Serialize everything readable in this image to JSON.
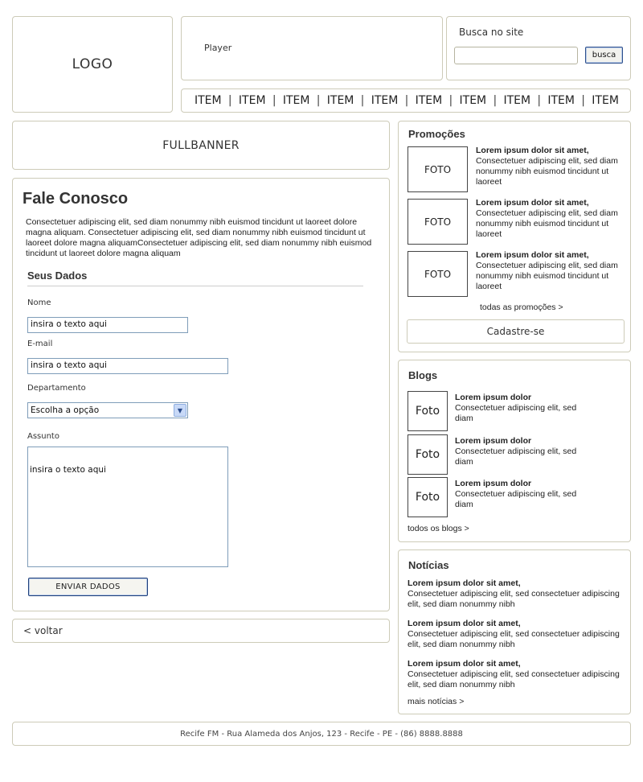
{
  "header": {
    "logo": "LOGO",
    "player": "Player",
    "search": {
      "label": "Busca no site",
      "value": "",
      "button": "busca"
    },
    "nav": {
      "items": [
        "ITEM",
        "ITEM",
        "ITEM",
        "ITEM",
        "ITEM",
        "ITEM",
        "ITEM",
        "ITEM",
        "ITEM",
        "ITEM"
      ],
      "separator": "|"
    }
  },
  "fullbanner": "FULLBANNER",
  "contact": {
    "title": "Fale Conosco",
    "intro": "Consectetuer adipiscing elit, sed diam nonummy nibh euismod tincidunt ut laoreet dolore magna aliquam. Consectetuer adipiscing elit, sed diam nonummy nibh euismod tincidunt ut laoreet dolore magna aliquamConsectetuer adipiscing elit, sed diam nonummy nibh euismod tincidunt ut laoreet dolore magna aliquam",
    "section": "Seus Dados",
    "name": {
      "label": "Nome",
      "value": "insira o texto aqui"
    },
    "email": {
      "label": "E-mail",
      "value": "insira o texto aqui"
    },
    "department": {
      "label": "Departamento",
      "value": "Escolha a opção"
    },
    "subject": {
      "label": "Assunto",
      "value": "insira o texto aqui"
    },
    "submit": "ENVIAR DADOS"
  },
  "back": "< voltar",
  "promos": {
    "title": "Promoções",
    "items": [
      {
        "photo": "FOTO",
        "title": "Lorem ipsum dolor sit amet,",
        "text": "Consectetuer adipiscing elit, sed diam nonummy nibh euismod tincidunt ut laoreet"
      },
      {
        "photo": "FOTO",
        "title": "Lorem ipsum dolor sit amet,",
        "text": "Consectetuer adipiscing elit, sed diam nonummy nibh euismod tincidunt ut laoreet"
      },
      {
        "photo": "FOTO",
        "title": "Lorem ipsum dolor sit amet,",
        "text": "Consectetuer adipiscing elit, sed diam nonummy nibh euismod tincidunt ut laoreet"
      }
    ],
    "more": "todas as promoções >",
    "signup": "Cadastre-se"
  },
  "blogs": {
    "title": "Blogs",
    "items": [
      {
        "photo": "Foto",
        "title": "Lorem ipsum dolor",
        "text": "Consectetuer adipiscing elit, sed diam"
      },
      {
        "photo": "Foto",
        "title": "Lorem ipsum dolor",
        "text": "Consectetuer adipiscing elit, sed diam"
      },
      {
        "photo": "Foto",
        "title": "Lorem ipsum dolor",
        "text": "Consectetuer adipiscing elit, sed diam"
      }
    ],
    "more": "todos os blogs >"
  },
  "news": {
    "title": "Notícias",
    "items": [
      {
        "title": "Lorem ipsum dolor sit amet,",
        "text": "Consectetuer adipiscing elit, sed consectetuer adipiscing elit, sed diam nonummy nibh"
      },
      {
        "title": "Lorem ipsum dolor sit amet,",
        "text": "Consectetuer adipiscing elit, sed consectetuer adipiscing elit, sed diam nonummy nibh"
      },
      {
        "title": "Lorem ipsum dolor sit amet,",
        "text": "Consectetuer adipiscing elit, sed consectetuer adipiscing elit, sed diam nonummy nibh"
      }
    ],
    "more": "mais notícias >"
  },
  "footer": "Recife FM - Rua Alameda dos Anjos, 123 - Recife - PE - (86) 8888.8888"
}
